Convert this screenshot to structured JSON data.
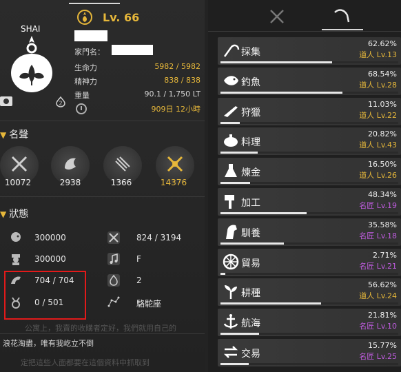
{
  "family_tag": "SHAI",
  "level": "Lv. 66",
  "family_name_label": "家門名：",
  "info": [
    {
      "label": "生命力",
      "value": "5982 / 5982"
    },
    {
      "label": "精神力",
      "value": "838 / 838"
    },
    {
      "label": "重量",
      "value": "90.1 / 1,750 LT"
    },
    {
      "label": "",
      "value": "909日 12小時"
    }
  ],
  "sections": {
    "renown": "名聲",
    "status": "狀態"
  },
  "renown": [
    {
      "icon": "crossed-swords-icon",
      "value": "10072"
    },
    {
      "icon": "dragon-icon",
      "value": "2938"
    },
    {
      "icon": "scroll-icon",
      "value": "1366"
    },
    {
      "icon": "golden-swords-icon",
      "value": "14376"
    }
  ],
  "status_left": [
    {
      "icon": "head-icon",
      "value": "300000"
    },
    {
      "icon": "officer-icon",
      "value": "300000"
    },
    {
      "icon": "strength-icon",
      "value": "704 / 704"
    },
    {
      "icon": "medal-icon",
      "value": "0 / 501"
    }
  ],
  "status_right": [
    {
      "icon": "tools-icon",
      "value": "824 / 3194"
    },
    {
      "icon": "music-icon",
      "value": "F"
    },
    {
      "icon": "flame-icon",
      "value": "2"
    },
    {
      "icon": "constellation-icon",
      "value": "駱駝座"
    }
  ],
  "chat": {
    "line1_faint": "公寓上，我賣的收購者定好，我們就用自己的",
    "line2": "浪花淘盡，唯有我屹立不倒",
    "line3_faint": "定把這些人面都要在這個資料中抓取到"
  },
  "lifeskills": [
    {
      "name": "採集",
      "pct": "62.62%",
      "rank": "道人 Lv.13",
      "fill": 0.6262,
      "color": "#e6b73a",
      "icon": "sickle-icon"
    },
    {
      "name": "釣魚",
      "pct": "68.54%",
      "rank": "道人 Lv.28",
      "fill": 0.6854,
      "color": "#e6b73a",
      "icon": "fish-icon"
    },
    {
      "name": "狩獵",
      "pct": "11.03%",
      "rank": "道人 Lv.22",
      "fill": 0.1103,
      "color": "#e6b73a",
      "icon": "rifle-icon"
    },
    {
      "name": "料理",
      "pct": "20.82%",
      "rank": "道人 Lv.43",
      "fill": 0.2082,
      "color": "#e6b73a",
      "icon": "roast-icon"
    },
    {
      "name": "煉金",
      "pct": "16.50%",
      "rank": "道人 Lv.26",
      "fill": 0.165,
      "color": "#e6b73a",
      "icon": "flask-icon"
    },
    {
      "name": "加工",
      "pct": "48.34%",
      "rank": "名匠 Lv.19",
      "fill": 0.4834,
      "color": "#c05ce0",
      "icon": "hammer-icon"
    },
    {
      "name": "馴養",
      "pct": "35.58%",
      "rank": "名匠 Lv.18",
      "fill": 0.3558,
      "color": "#c05ce0",
      "icon": "horse-icon"
    },
    {
      "name": "貿易",
      "pct": "2.71%",
      "rank": "名匠 Lv.21",
      "fill": 0.0271,
      "color": "#c05ce0",
      "icon": "wheel-icon"
    },
    {
      "name": "耕種",
      "pct": "56.62%",
      "rank": "道人 Lv.24",
      "fill": 0.5662,
      "color": "#e6b73a",
      "icon": "sprout-icon"
    },
    {
      "name": "航海",
      "pct": "21.81%",
      "rank": "名匠 Lv.10",
      "fill": 0.2181,
      "color": "#c05ce0",
      "icon": "anchor-icon"
    },
    {
      "name": "交易",
      "pct": "15.77%",
      "rank": "名匠 Lv.25",
      "fill": 0.1577,
      "color": "#c05ce0",
      "icon": "exchange-icon"
    }
  ]
}
